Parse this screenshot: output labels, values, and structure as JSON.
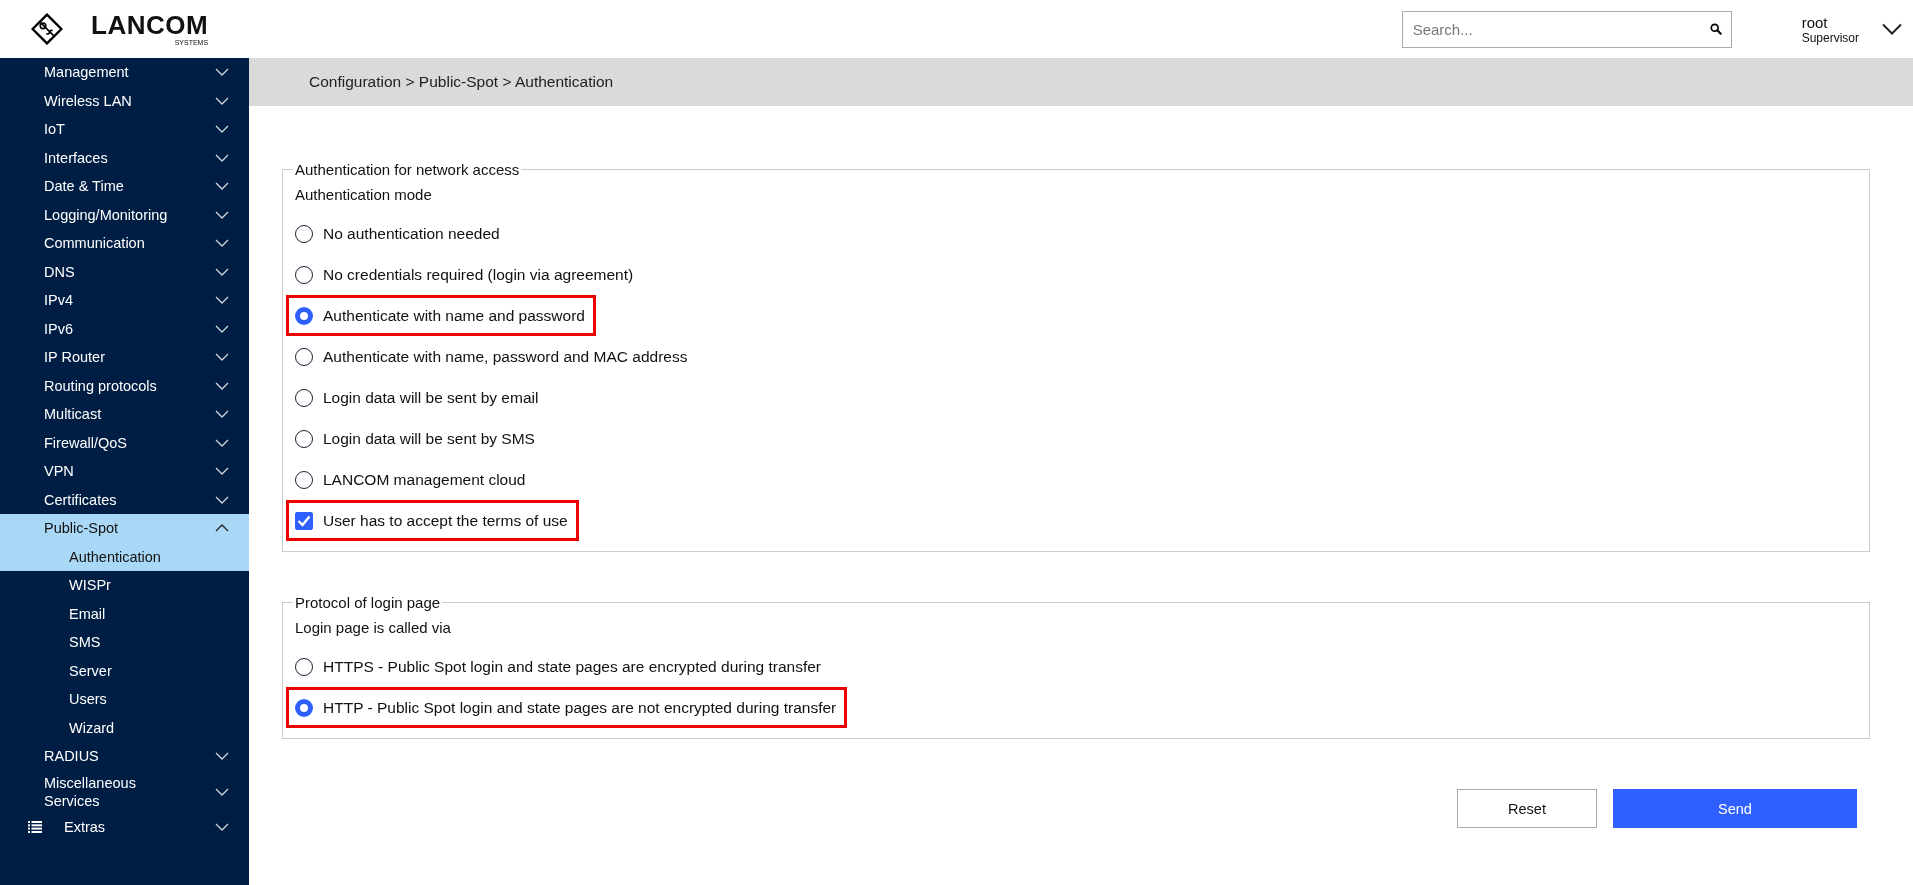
{
  "header": {
    "logo_text": "LANCOM",
    "logo_subtext": "SYSTEMS",
    "search": {
      "placeholder": "Search..."
    },
    "user": {
      "name": "root",
      "role": "Supervisor"
    }
  },
  "sidebar": {
    "items": [
      {
        "label": "Management",
        "expanded": false,
        "selected": false
      },
      {
        "label": "Wireless LAN",
        "expanded": false,
        "selected": false
      },
      {
        "label": "IoT",
        "expanded": false,
        "selected": false
      },
      {
        "label": "Interfaces",
        "expanded": false,
        "selected": false
      },
      {
        "label": "Date & Time",
        "expanded": false,
        "selected": false
      },
      {
        "label": "Logging/Monitoring",
        "expanded": false,
        "selected": false
      },
      {
        "label": "Communication",
        "expanded": false,
        "selected": false
      },
      {
        "label": "DNS",
        "expanded": false,
        "selected": false
      },
      {
        "label": "IPv4",
        "expanded": false,
        "selected": false
      },
      {
        "label": "IPv6",
        "expanded": false,
        "selected": false
      },
      {
        "label": "IP Router",
        "expanded": false,
        "selected": false
      },
      {
        "label": "Routing protocols",
        "expanded": false,
        "selected": false
      },
      {
        "label": "Multicast",
        "expanded": false,
        "selected": false
      },
      {
        "label": "Firewall/QoS",
        "expanded": false,
        "selected": false
      },
      {
        "label": "VPN",
        "expanded": false,
        "selected": false
      },
      {
        "label": "Certificates",
        "expanded": false,
        "selected": false
      },
      {
        "label": "Public-Spot",
        "expanded": true,
        "selected": true,
        "children": [
          {
            "label": "Authentication",
            "selected": true
          },
          {
            "label": "WISPr",
            "selected": false
          },
          {
            "label": "Email",
            "selected": false
          },
          {
            "label": "SMS",
            "selected": false
          },
          {
            "label": "Server",
            "selected": false
          },
          {
            "label": "Users",
            "selected": false
          },
          {
            "label": "Wizard",
            "selected": false
          }
        ]
      },
      {
        "label": "RADIUS",
        "expanded": false,
        "selected": false
      },
      {
        "label": "Miscellaneous Services",
        "expanded": false,
        "selected": false
      },
      {
        "label": "Extras",
        "expanded": false,
        "selected": false,
        "kind": "icon"
      }
    ]
  },
  "breadcrumb": "Configuration > Public-Spot > Authentication",
  "sections": [
    {
      "legend": "Authentication for network access",
      "subtitle": "Authentication mode",
      "options": [
        {
          "kind": "radio",
          "label": "No authentication needed",
          "selected": false,
          "highlighted": false
        },
        {
          "kind": "radio",
          "label": "No credentials required (login via agreement)",
          "selected": false,
          "highlighted": false
        },
        {
          "kind": "radio",
          "label": "Authenticate with name and password",
          "selected": true,
          "highlighted": true
        },
        {
          "kind": "radio",
          "label": "Authenticate with name, password and MAC address",
          "selected": false,
          "highlighted": false
        },
        {
          "kind": "radio",
          "label": "Login data will be sent by email",
          "selected": false,
          "highlighted": false
        },
        {
          "kind": "radio",
          "label": "Login data will be sent by SMS",
          "selected": false,
          "highlighted": false
        },
        {
          "kind": "radio",
          "label": "LANCOM management cloud",
          "selected": false,
          "highlighted": false
        },
        {
          "kind": "checkbox",
          "label": "User has to accept the terms of use",
          "checked": true,
          "highlighted": true
        }
      ]
    },
    {
      "legend": "Protocol of login page",
      "subtitle": "Login page is called via",
      "options": [
        {
          "kind": "radio",
          "label": "HTTPS - Public Spot login and state pages are encrypted during transfer",
          "selected": false,
          "highlighted": false
        },
        {
          "kind": "radio",
          "label": "HTTP - Public Spot login and state pages are not encrypted during transfer",
          "selected": true,
          "highlighted": true
        }
      ]
    }
  ],
  "buttons": [
    {
      "label": "Reset",
      "kind": "secondary"
    },
    {
      "label": "Send",
      "kind": "primary"
    }
  ]
}
